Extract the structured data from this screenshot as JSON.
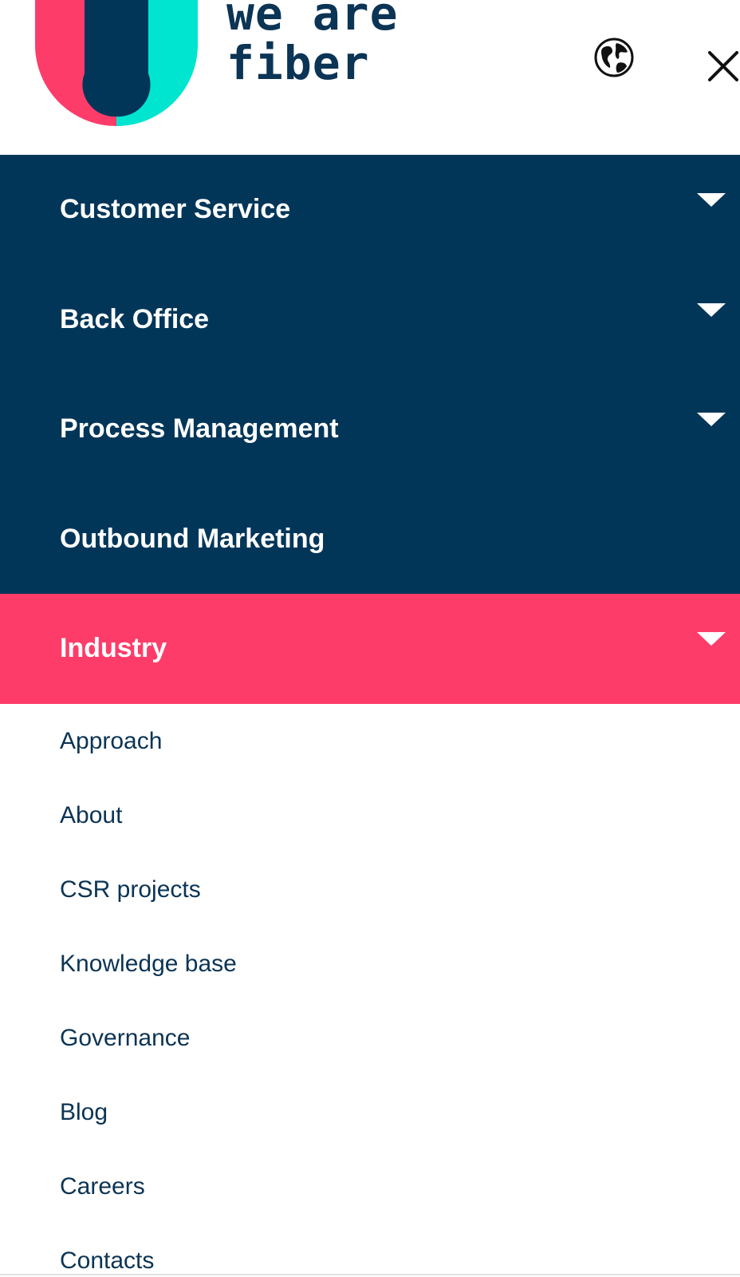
{
  "brand": {
    "logo_text_line1": "we are",
    "logo_text_line2": "fiber",
    "colors": {
      "navy": "#023659",
      "pink": "#fe3c6a",
      "teal": "#00e5d0",
      "text": "#0b3455"
    }
  },
  "header": {
    "globe_icon": "globe-icon",
    "close_icon": "close-icon"
  },
  "menu": {
    "primary": [
      {
        "label": "Customer Service",
        "has_dropdown": true
      },
      {
        "label": "Back Office",
        "has_dropdown": true
      },
      {
        "label": "Process Management",
        "has_dropdown": true
      },
      {
        "label": "Outbound Marketing",
        "has_dropdown": false
      },
      {
        "label": "Industry",
        "has_dropdown": true,
        "active": true
      }
    ],
    "secondary": [
      {
        "label": "Approach"
      },
      {
        "label": "About"
      },
      {
        "label": "CSR projects"
      },
      {
        "label": "Knowledge base"
      },
      {
        "label": "Governance"
      },
      {
        "label": "Blog"
      },
      {
        "label": "Careers"
      },
      {
        "label": "Contacts"
      }
    ]
  }
}
